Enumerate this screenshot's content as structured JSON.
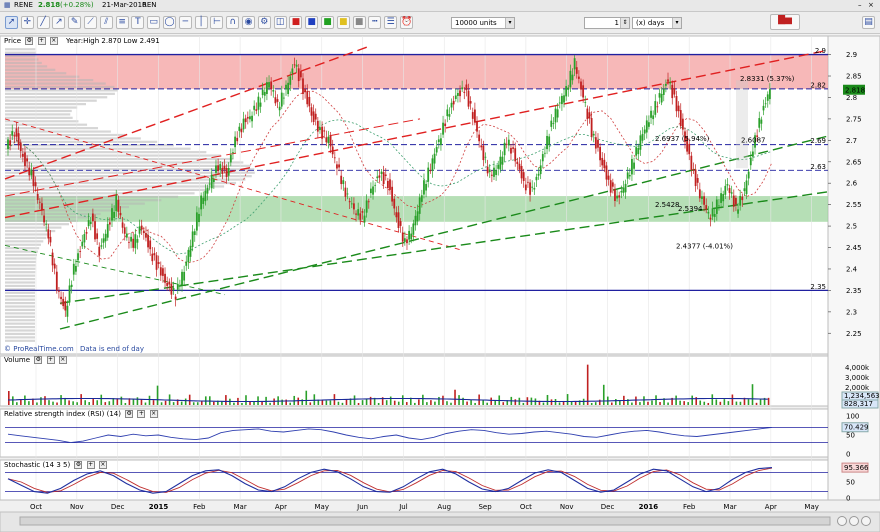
{
  "window": {
    "symbol": "RENE",
    "price": "2.818",
    "change": "(+0.28%)",
    "date": "21-Mar-2016",
    "name": "REN"
  },
  "toolbar": {
    "icons": [
      "cursor-icon",
      "crosshair-icon",
      "line-icon",
      "arrow-icon",
      "pencil-icon",
      "ray-icon",
      "channel-icon",
      "fibonacci-icon",
      "text-icon",
      "rectangle-icon",
      "ellipse-icon",
      "horizontal-line-icon",
      "vertical-line-icon",
      "measure-icon",
      "magnet-icon",
      "eye-icon",
      "settings-icon",
      "layers-icon",
      "color-red-icon",
      "color-blue-icon",
      "color-green-icon",
      "color-yellow-icon",
      "color-gray-icon",
      "line-style-icon",
      "line-width-icon",
      "alert-icon"
    ],
    "units_value": "10000 units",
    "period_value": "1",
    "period_unit": "(x) days"
  },
  "price_panel": {
    "label": "Price",
    "info": "Year:High 2.870 Low 2.491",
    "credit": "© ProRealTime.com",
    "credit_note": "Data is end of day"
  },
  "volume_panel": {
    "label": "Volume"
  },
  "rsi_panel": {
    "label": "Relative strength index (RSI) (14)"
  },
  "stoch_panel": {
    "label": "Stochastic (14 3 5)"
  },
  "colors": {
    "resistance_zone": "#f4a0a0",
    "support_zone": "#9ed49e",
    "red_trend": "#e02020",
    "green_trend": "#1a8a1a",
    "blue_line": "#2020a0",
    "candle_up": "#2aa02a",
    "candle_down": "#c02020"
  },
  "chart_data": {
    "type": "candlestick",
    "x_ticks": [
      "Oct",
      "Nov",
      "Dec",
      "2015",
      "Feb",
      "Mar",
      "Apr",
      "May",
      "Jun",
      "Jul",
      "Aug",
      "Sep",
      "Oct",
      "Nov",
      "Dec",
      "2016",
      "Feb",
      "Mar",
      "Apr",
      "May"
    ],
    "y_ticks": [
      "2.9",
      "2.85",
      "2.8",
      "2.75",
      "2.7",
      "2.65",
      "2.6",
      "2.55",
      "2.5",
      "2.45",
      "2.4",
      "2.35",
      "2.3",
      "2.25"
    ],
    "ylim": [
      2.225,
      2.92
    ],
    "level_labels": [
      "2.9",
      "2.82",
      "2.69",
      "2.63",
      "2.35"
    ],
    "last_price": "2.818",
    "annotations": [
      "2.8331 (5.37%)",
      "2.6937 (5.94%)",
      "2.6087",
      "2.5428",
      "2.5394",
      "2.4377 (-4.01%)"
    ],
    "horizontal_levels": [
      2.9,
      2.82,
      2.69,
      2.63,
      2.35
    ],
    "support_zone": [
      2.51,
      2.57
    ],
    "resistance_zone": [
      2.82,
      2.9
    ],
    "price_series": [
      2.68,
      2.72,
      2.66,
      2.62,
      2.55,
      2.48,
      2.36,
      2.3,
      2.4,
      2.46,
      2.52,
      2.44,
      2.5,
      2.56,
      2.48,
      2.46,
      2.5,
      2.44,
      2.4,
      2.36,
      2.34,
      2.4,
      2.48,
      2.56,
      2.6,
      2.64,
      2.62,
      2.7,
      2.74,
      2.76,
      2.8,
      2.84,
      2.78,
      2.82,
      2.88,
      2.82,
      2.76,
      2.72,
      2.7,
      2.64,
      2.58,
      2.54,
      2.52,
      2.58,
      2.62,
      2.6,
      2.52,
      2.46,
      2.5,
      2.58,
      2.64,
      2.7,
      2.76,
      2.8,
      2.82,
      2.76,
      2.68,
      2.62,
      2.64,
      2.7,
      2.66,
      2.6,
      2.58,
      2.64,
      2.72,
      2.78,
      2.82,
      2.88,
      2.8,
      2.72,
      2.66,
      2.6,
      2.56,
      2.6,
      2.66,
      2.72,
      2.76,
      2.8,
      2.84,
      2.78,
      2.7,
      2.62,
      2.56,
      2.52,
      2.56,
      2.6,
      2.54,
      2.58,
      2.68,
      2.76,
      2.82
    ],
    "volume_axis": [
      "4,000k",
      "3,000k",
      "2,000k",
      "1,000k"
    ],
    "volume_labels": [
      "1,234,563",
      "828,317"
    ],
    "rsi_axis": [
      "100",
      "50",
      "0"
    ],
    "rsi_value": "70.429",
    "rsi_series": [
      52,
      48,
      44,
      40,
      36,
      30,
      34,
      42,
      50,
      46,
      52,
      48,
      50,
      44,
      40,
      38,
      42,
      56,
      62,
      64,
      66,
      60,
      58,
      62,
      66,
      64,
      58,
      50,
      44,
      40,
      46,
      50,
      42,
      38,
      44,
      54,
      60,
      64,
      62,
      56,
      52,
      54,
      58,
      60,
      56,
      52,
      46,
      44,
      50,
      56,
      60,
      62,
      58,
      52,
      48,
      46,
      50,
      54,
      58,
      62,
      66,
      70
    ],
    "stoch_axis": [
      "100",
      "50",
      "0"
    ],
    "stoch_value": "95.366",
    "stoch_series": [
      60,
      40,
      20,
      15,
      30,
      55,
      75,
      85,
      70,
      45,
      25,
      15,
      20,
      45,
      70,
      85,
      88,
      70,
      45,
      25,
      20,
      35,
      60,
      80,
      90,
      82,
      60,
      35,
      20,
      18,
      35,
      60,
      82,
      90,
      75,
      50,
      28,
      20,
      30,
      55,
      78,
      88,
      80,
      55,
      30,
      18,
      25,
      50,
      75,
      90,
      85,
      60,
      35,
      20,
      30,
      58,
      80,
      92,
      95
    ]
  }
}
